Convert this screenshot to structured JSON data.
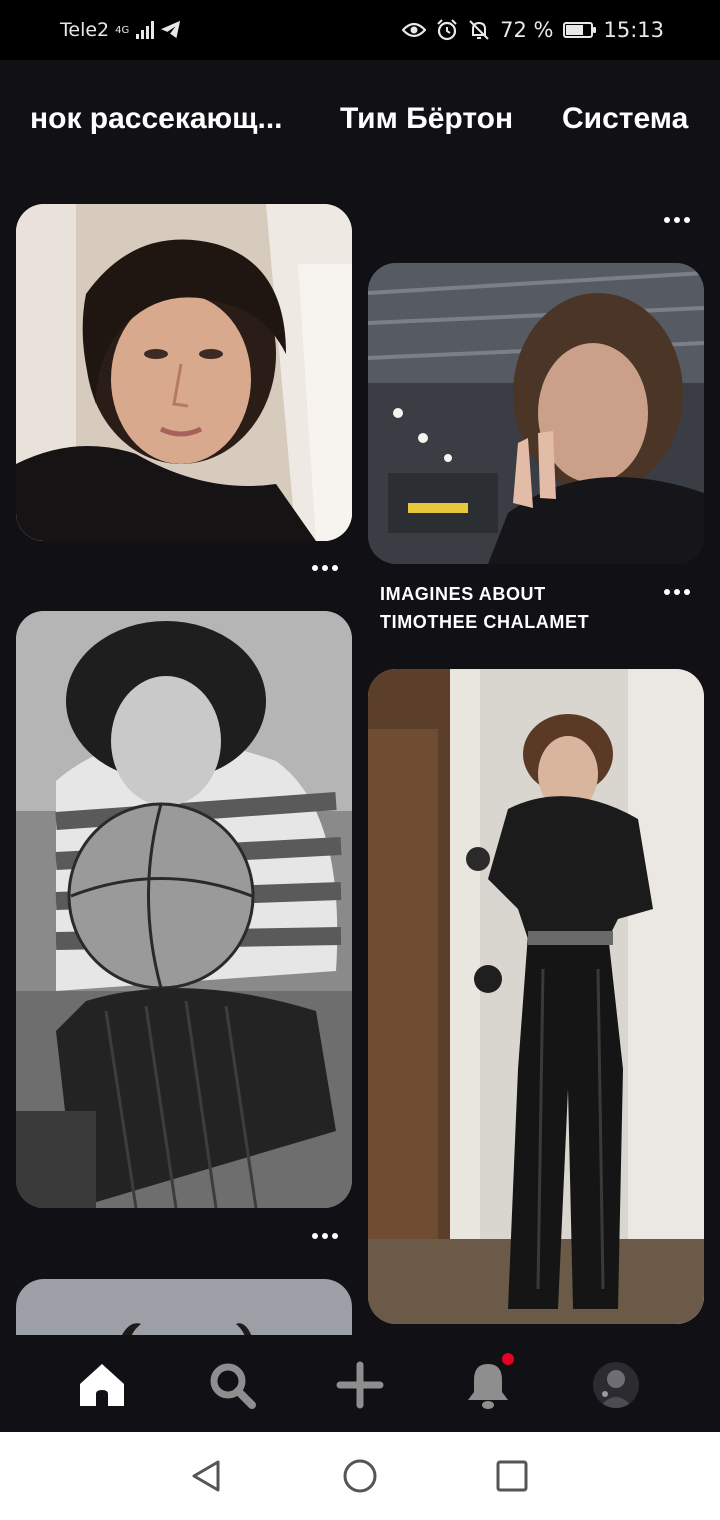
{
  "status_bar": {
    "carrier": "Tele2",
    "network_type": "4G",
    "battery": "72 %",
    "battery_level": 0.72,
    "time": "15:13"
  },
  "topics": [
    "нок рассекающ...",
    "Тим Бёртон",
    "Система"
  ],
  "pins": [
    {
      "title": ""
    },
    {
      "title": "IMAGINES ABOUT TIMOTHEE CHALAMET"
    },
    {
      "title": ""
    },
    {
      "title": ""
    },
    {
      "title": ""
    }
  ],
  "colors": {
    "background": "#111014",
    "status_bar": "#000000",
    "notification_badge": "#e60023",
    "nav_active": "#ffffff",
    "nav_inactive": "#8e8e8e"
  },
  "bottom_nav": {
    "items": [
      "home-icon",
      "search-icon",
      "plus-icon",
      "bell-icon",
      "profile-avatar"
    ],
    "active": "home-icon"
  }
}
